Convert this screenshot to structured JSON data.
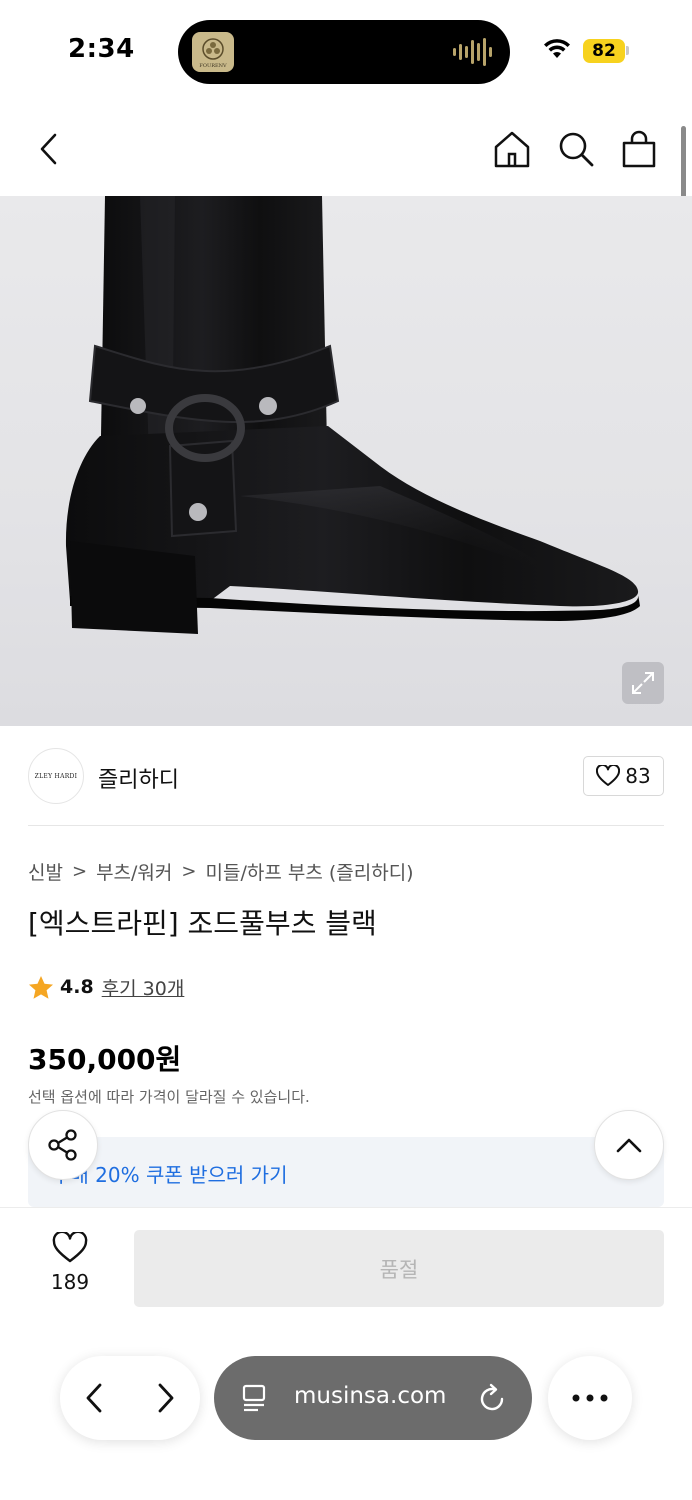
{
  "status_bar": {
    "time": "2:34",
    "battery": "82",
    "island_app_text": "FOURENV"
  },
  "colors": {
    "accent_blue": "#1f6ee0",
    "rating_star": "#f5a623",
    "battery": "#f7d21e"
  },
  "top_nav": {
    "icons": [
      "back-arrow-icon",
      "home-icon",
      "search-icon",
      "shopping-bag-icon"
    ]
  },
  "brand": {
    "logo_text": "ZLEY HARDI",
    "name": "즐리하디",
    "like_count": "83"
  },
  "breadcrumb": [
    "신발",
    "부츠/워커",
    "미들/하프 부츠 (즐리하디)"
  ],
  "product": {
    "title": "[엑스트라핀] 조드풀부츠 블랙",
    "rating": "4.8",
    "review_link": "후기 30개",
    "price": "350,000원",
    "price_note": "선택 옵션에 따라 가격이 달라질 수 있습니다."
  },
  "coupon": {
    "text": "구매 20% 쿠폰 받으러 가기"
  },
  "purchase_bar": {
    "wish_count": "189",
    "soldout_label": "품절"
  },
  "browser": {
    "url": "musinsa.com"
  }
}
